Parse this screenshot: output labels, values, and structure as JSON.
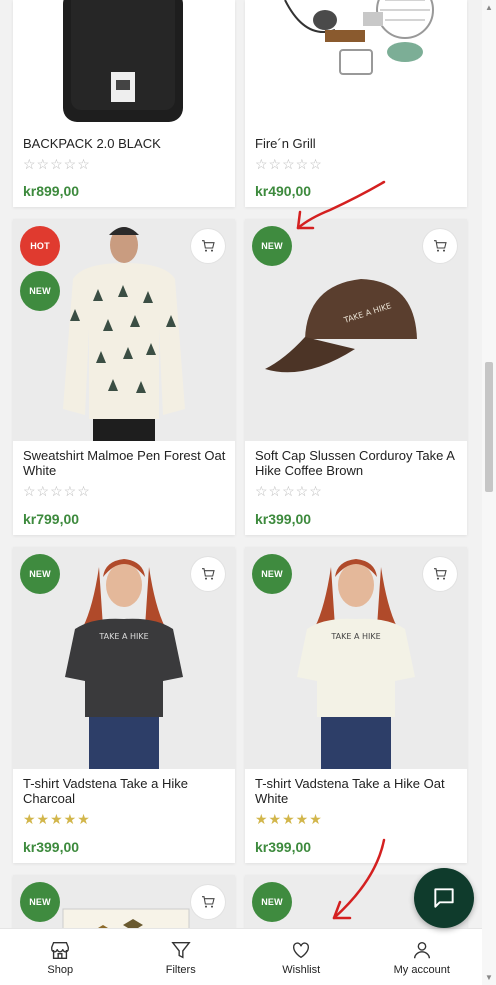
{
  "products": [
    {
      "title": "BACKPACK 2.0 BLACK",
      "price": "kr899,00",
      "rating": 0
    },
    {
      "title": "Fire´n Grill",
      "price": "kr490,00",
      "rating": 0
    },
    {
      "title": "Sweatshirt Malmoe Pen Forest Oat White",
      "price": "kr799,00",
      "rating": 0,
      "badges": [
        "HOT",
        "NEW"
      ]
    },
    {
      "title": "Soft Cap Slussen Corduroy Take A Hike Coffee Brown",
      "price": "kr399,00",
      "rating": 0,
      "badges": [
        "NEW"
      ]
    },
    {
      "title": "T-shirt Vadstena Take a Hike Charcoal",
      "price": "kr399,00",
      "rating": 5,
      "badges": [
        "NEW"
      ]
    },
    {
      "title": "T-shirt Vadstena Take a Hike Oat White",
      "price": "kr399,00",
      "rating": 5,
      "badges": [
        "NEW"
      ]
    },
    {
      "badges": [
        "NEW"
      ]
    },
    {
      "badges": [
        "NEW"
      ]
    }
  ],
  "stars_empty": "☆☆☆☆☆",
  "stars_full": "★★★★★",
  "product_image_text": {
    "cap": "TAKE A HIKE",
    "tee": "TAKE A HIKE"
  },
  "bottom_nav": [
    {
      "label": "Shop",
      "icon": "shop-icon"
    },
    {
      "label": "Filters",
      "icon": "filter-icon"
    },
    {
      "label": "Wishlist",
      "icon": "heart-icon"
    },
    {
      "label": "My account",
      "icon": "user-icon"
    }
  ],
  "colors": {
    "price": "#3d8a3d",
    "badge_new": "#3f8b3f",
    "badge_hot": "#e03a2f",
    "rating": "#d2b64b",
    "chat": "#0f3b2c",
    "annotation": "#d42020"
  }
}
